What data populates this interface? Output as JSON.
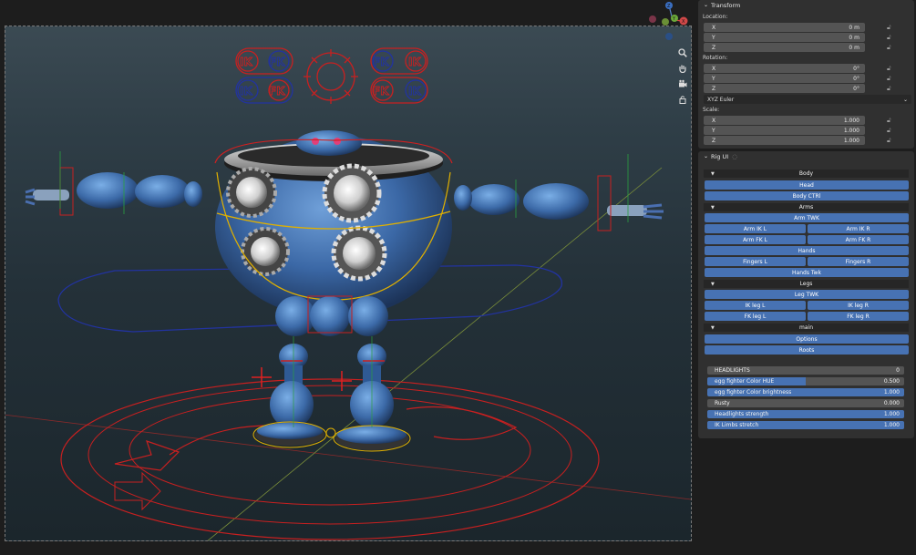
{
  "transform": {
    "title": "Transform",
    "location_label": "Location:",
    "rotation_label": "Rotation:",
    "scale_label": "Scale:",
    "location": [
      {
        "axis": "X",
        "value": "0 m"
      },
      {
        "axis": "Y",
        "value": "0 m"
      },
      {
        "axis": "Z",
        "value": "0 m"
      }
    ],
    "rotation": [
      {
        "axis": "X",
        "value": "0°"
      },
      {
        "axis": "Y",
        "value": "0°"
      },
      {
        "axis": "Z",
        "value": "0°"
      }
    ],
    "rotation_mode": "XYZ Euler",
    "scale": [
      {
        "axis": "X",
        "value": "1.000"
      },
      {
        "axis": "Y",
        "value": "1.000"
      },
      {
        "axis": "Z",
        "value": "1.000"
      }
    ]
  },
  "rig_ui": {
    "title": "Rig UI",
    "sections": {
      "body": "Body",
      "arms": "Arms",
      "legs": "Legs",
      "main": "main"
    },
    "buttons": {
      "head": "Head",
      "body_ctrl": "Body CTRl",
      "arm_twk": "Arm TWK",
      "arm_ik_l": "Arm IK L",
      "arm_ik_r": "Arm IK R",
      "arm_fk_l": "Arm FK L",
      "arm_fk_r": "Arm FK R",
      "hands": "Hands",
      "fingers_l": "Fingers L",
      "fingers_r": "Fingers R",
      "hands_twk": "Hands Twk",
      "leg_twk": "Leg TWK",
      "ik_leg_l": "IK leg L",
      "ik_leg_r": "IK leg R",
      "fk_leg_l": "FK leg L",
      "fk_leg_r": "FK leg R",
      "options": "Options",
      "roots": "Roots"
    },
    "properties": [
      {
        "label": "HEADLIGHTS",
        "value": "0",
        "fill": 0.0
      },
      {
        "label": "egg fighter Color HUE",
        "value": "0.500",
        "fill": 0.5
      },
      {
        "label": "egg fighter Color brightness",
        "value": "1.000",
        "fill": 1.0
      },
      {
        "label": "Rusty",
        "value": "0.000",
        "fill": 0.0
      },
      {
        "label": "Headlights strength",
        "value": "1.000",
        "fill": 1.0
      },
      {
        "label": "IK Limbs stretch",
        "value": "1.000",
        "fill": 1.0
      }
    ]
  },
  "viewport": {
    "ik_fk_labels": [
      "IK",
      "FK"
    ],
    "tools": [
      "zoom-icon",
      "hand-pan-icon",
      "camera-icon",
      "lock-icon"
    ],
    "gizmo_axes": {
      "x": "X",
      "y": "Y",
      "z": "Z"
    }
  },
  "colors": {
    "accent": "#4772b3",
    "panel_bg": "#303030",
    "rig_red": "#d02020",
    "rig_blue": "#2233a0",
    "robot_blue": "#3d6fb0"
  }
}
